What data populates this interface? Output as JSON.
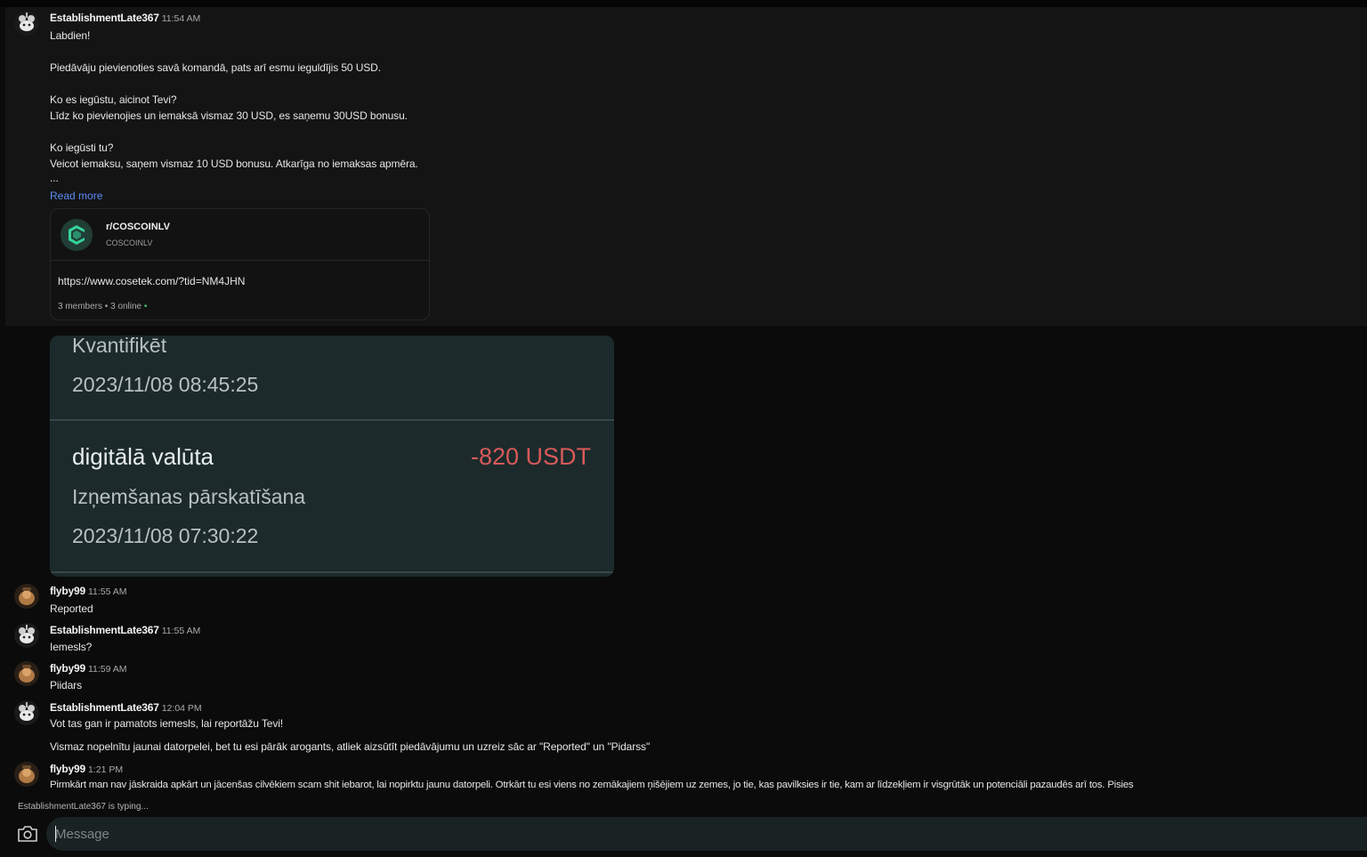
{
  "messages": [
    {
      "user": "EstablishmentLate367",
      "time": "11:54 AM",
      "lines": [
        "Labdien!",
        "Piedāvāju pievienoties savā komandā, pats arī esmu ieguldījis 50 USD.",
        "Ko es iegūstu, aicinot Tevi?",
        "Līdz ko pievienojies un iemaksā vismaz 30 USD, es saņemu 30USD bonusu.",
        "Ko iegūsti tu?",
        "Veicot iemaksu, saņem vismaz 10 USD bonusu. Atkarīga no iemaksas apmēra.",
        "..."
      ],
      "read_more": "Read more",
      "community_card": {
        "name": "r/COSCOINLV",
        "subtitle": "COSCOINLV",
        "link": "https://www.cosetek.com/?tid=NM4JHN",
        "stats": "3 members • 3 online",
        "online_dot": "•"
      }
    },
    {
      "user": "flyby99",
      "time": "11:55 AM",
      "lines": [
        "Reported"
      ]
    },
    {
      "user": "EstablishmentLate367",
      "time": "11:55 AM",
      "lines": [
        "Iemesls?"
      ]
    },
    {
      "user": "flyby99",
      "time": "11:59 AM",
      "lines": [
        "Piidars"
      ]
    },
    {
      "user": "EstablishmentLate367",
      "time": "12:04 PM",
      "lines": [
        "Vot tas gan ir pamatots iemesls, lai reportāžu Tevi!",
        "Vismaz nopelnītu jaunai datorpelei, bet tu esi pārāk arogants, atliek aizsūtīt piedāvājumu un uzreiz sāc ar \"Reported\" un \"Pidarss\""
      ]
    },
    {
      "user": "flyby99",
      "time": "1:21 PM",
      "lines": [
        "Pirmkārt man nav jāskraida apkārt un jācenšas cilvēkiem scam shit iebarot, lai nopirktu jaunu datorpeli. Otrkārt tu esi viens no zemākajiem ņišējiem uz zemes, jo tie, kas pavilksies ir tie, kam ar līdzekļiem ir visgrūtāk un potenciāli pazaudēs arī tos. Pisies"
      ]
    }
  ],
  "screenshot_image": {
    "top_label": "Kvantifikēt",
    "top_date": "2023/11/08 08:45:25",
    "title": "digitālā valūta",
    "amount": "-820 USDT",
    "status": "Izņemšanas pārskatīšana",
    "date": "2023/11/08 07:30:22"
  },
  "typing_indicator": "EstablishmentLate367 is typing...",
  "composer": {
    "placeholder": "Message"
  },
  "icons": {
    "camera": "camera-icon",
    "avatar_snoo": "snoo-avatar-icon",
    "avatar_flyby": "flyby-avatar-icon",
    "community": "coscoin-logo-icon"
  },
  "colors": {
    "link": "#5b8cf5",
    "amount_negative": "#d85a59",
    "online": "#3fc37e"
  }
}
